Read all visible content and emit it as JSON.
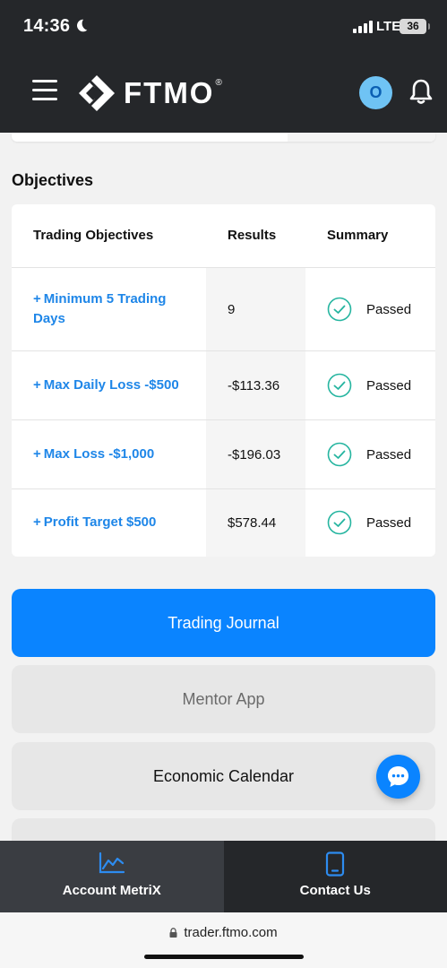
{
  "status_bar": {
    "time": "14:36",
    "network": "LTE",
    "battery": "36"
  },
  "header": {
    "logo_text": "FTMO",
    "logo_reg": "®",
    "avatar_initial": "O"
  },
  "objectives": {
    "title": "Objectives",
    "columns": [
      "Trading Objectives",
      "Results",
      "Summary"
    ],
    "rows": [
      {
        "plus": "+",
        "objective": "Minimum 5 Trading Days",
        "result": "9",
        "summary": "Passed"
      },
      {
        "plus": "+",
        "objective": "Max Daily Loss -$500",
        "result": "-$113.36",
        "summary": "Passed"
      },
      {
        "plus": "+",
        "objective": "Max Loss -$1,000",
        "result": "-$196.03",
        "summary": "Passed"
      },
      {
        "plus": "+",
        "objective": "Profit Target $500",
        "result": "$578.44",
        "summary": "Passed"
      }
    ]
  },
  "buttons": {
    "trading_journal": "Trading Journal",
    "mentor_app": "Mentor App",
    "economic_calendar": "Economic Calendar"
  },
  "bottom_nav": {
    "account_metrix": "Account MetriX",
    "contact_us": "Contact Us"
  },
  "browser": {
    "url": "trader.ftmo.com"
  },
  "colors": {
    "accent": "#0a84ff",
    "link": "#1e86e8",
    "success": "#26b5a0",
    "dark": "#25272a"
  }
}
